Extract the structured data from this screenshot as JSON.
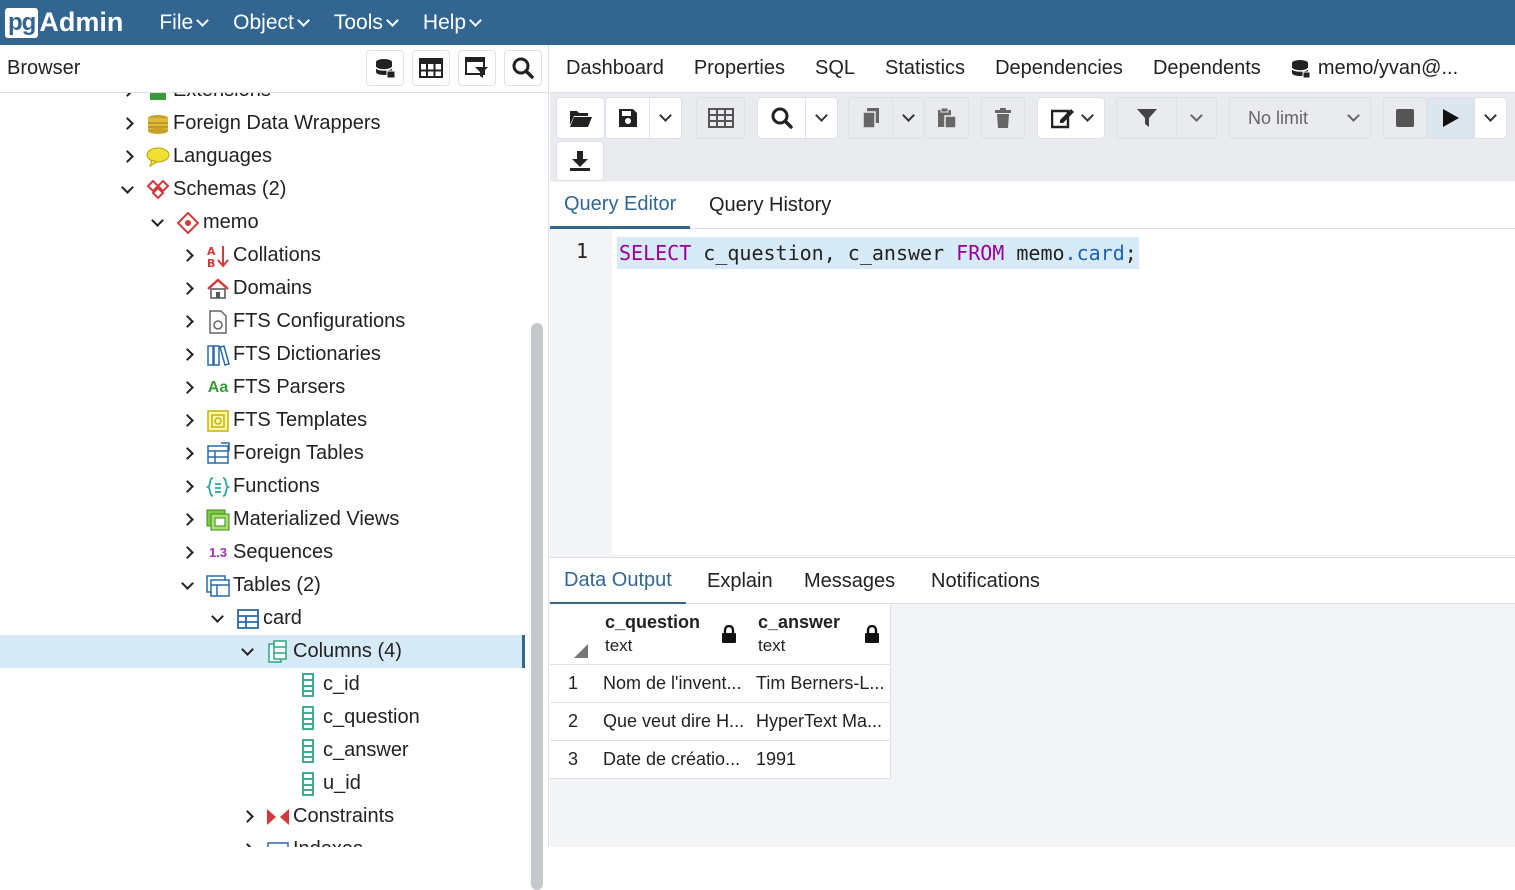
{
  "app": {
    "logo_pg": "pg",
    "logo_admin": "Admin"
  },
  "menu": [
    {
      "label": "File"
    },
    {
      "label": "Object"
    },
    {
      "label": "Tools"
    },
    {
      "label": "Help"
    }
  ],
  "browser": {
    "title": "Browser",
    "tree": [
      {
        "label": "Extensions",
        "icon": "extensions-icon",
        "caret": "right"
      },
      {
        "label": "Foreign Data Wrappers",
        "icon": "foreign-data-wrappers-icon",
        "caret": "right"
      },
      {
        "label": "Languages",
        "icon": "languages-icon",
        "caret": "right"
      },
      {
        "label": "Schemas (2)",
        "icon": "schemas-icon",
        "caret": "down"
      },
      {
        "label": "memo",
        "icon": "schema-icon",
        "caret": "down"
      },
      {
        "label": "Collations",
        "icon": "collations-icon",
        "caret": "right"
      },
      {
        "label": "Domains",
        "icon": "domains-icon",
        "caret": "right"
      },
      {
        "label": "FTS Configurations",
        "icon": "fts-configurations-icon",
        "caret": "right"
      },
      {
        "label": "FTS Dictionaries",
        "icon": "fts-dictionaries-icon",
        "caret": "right"
      },
      {
        "label": "FTS Parsers",
        "icon": "fts-parsers-icon",
        "caret": "right",
        "icon_text": "Aa"
      },
      {
        "label": "FTS Templates",
        "icon": "fts-templates-icon",
        "caret": "right"
      },
      {
        "label": "Foreign Tables",
        "icon": "foreign-tables-icon",
        "caret": "right"
      },
      {
        "label": "Functions",
        "icon": "functions-icon",
        "caret": "right"
      },
      {
        "label": "Materialized Views",
        "icon": "materialized-views-icon",
        "caret": "right"
      },
      {
        "label": "Sequences",
        "icon": "sequences-icon",
        "caret": "right",
        "icon_text": "1.3"
      },
      {
        "label": "Tables (2)",
        "icon": "tables-icon",
        "caret": "down"
      },
      {
        "label": "card",
        "icon": "table-icon",
        "caret": "down"
      },
      {
        "label": "Columns (4)",
        "icon": "columns-icon",
        "caret": "down",
        "selected": true
      },
      {
        "label": "c_id",
        "icon": "column-icon",
        "caret": "none"
      },
      {
        "label": "c_question",
        "icon": "column-icon",
        "caret": "none"
      },
      {
        "label": "c_answer",
        "icon": "column-icon",
        "caret": "none"
      },
      {
        "label": "u_id",
        "icon": "column-icon",
        "caret": "none"
      },
      {
        "label": "Constraints",
        "icon": "constraints-icon",
        "caret": "right"
      },
      {
        "label": "Indexes",
        "icon": "indexes-icon",
        "caret": "right"
      }
    ]
  },
  "right_tabs": [
    "Dashboard",
    "Properties",
    "SQL",
    "Statistics",
    "Dependencies",
    "Dependents"
  ],
  "db_tab": "memo/yvan@...",
  "toolbar": {
    "limit": "No limit"
  },
  "query_tabs": [
    "Query Editor",
    "Query History"
  ],
  "editor": {
    "line_number": "1",
    "tokens": [
      {
        "t": "SELECT",
        "c": "kw"
      },
      {
        "t": " c_question, c_answer ",
        "c": ""
      },
      {
        "t": "FROM",
        "c": "kw"
      },
      {
        "t": " memo",
        "c": ""
      },
      {
        "t": ".card",
        "c": "fld"
      },
      {
        "t": ";",
        "c": ""
      }
    ]
  },
  "output_tabs": [
    "Data Output",
    "Explain",
    "Messages",
    "Notifications"
  ],
  "grid": {
    "columns": [
      {
        "name": "c_question",
        "type": "text"
      },
      {
        "name": "c_answer",
        "type": "text"
      }
    ],
    "rows": [
      {
        "n": "1",
        "cells": [
          "Nom de l'invent...",
          "Tim Berners-L..."
        ]
      },
      {
        "n": "2",
        "cells": [
          "Que veut dire H...",
          "HyperText Ma..."
        ]
      },
      {
        "n": "3",
        "cells": [
          "Date de créatio...",
          "1991"
        ]
      }
    ]
  },
  "colors": {
    "brand": "#326690",
    "keyword": "#990099",
    "property": "#1a61b4",
    "selection": "#d6eaf8"
  }
}
